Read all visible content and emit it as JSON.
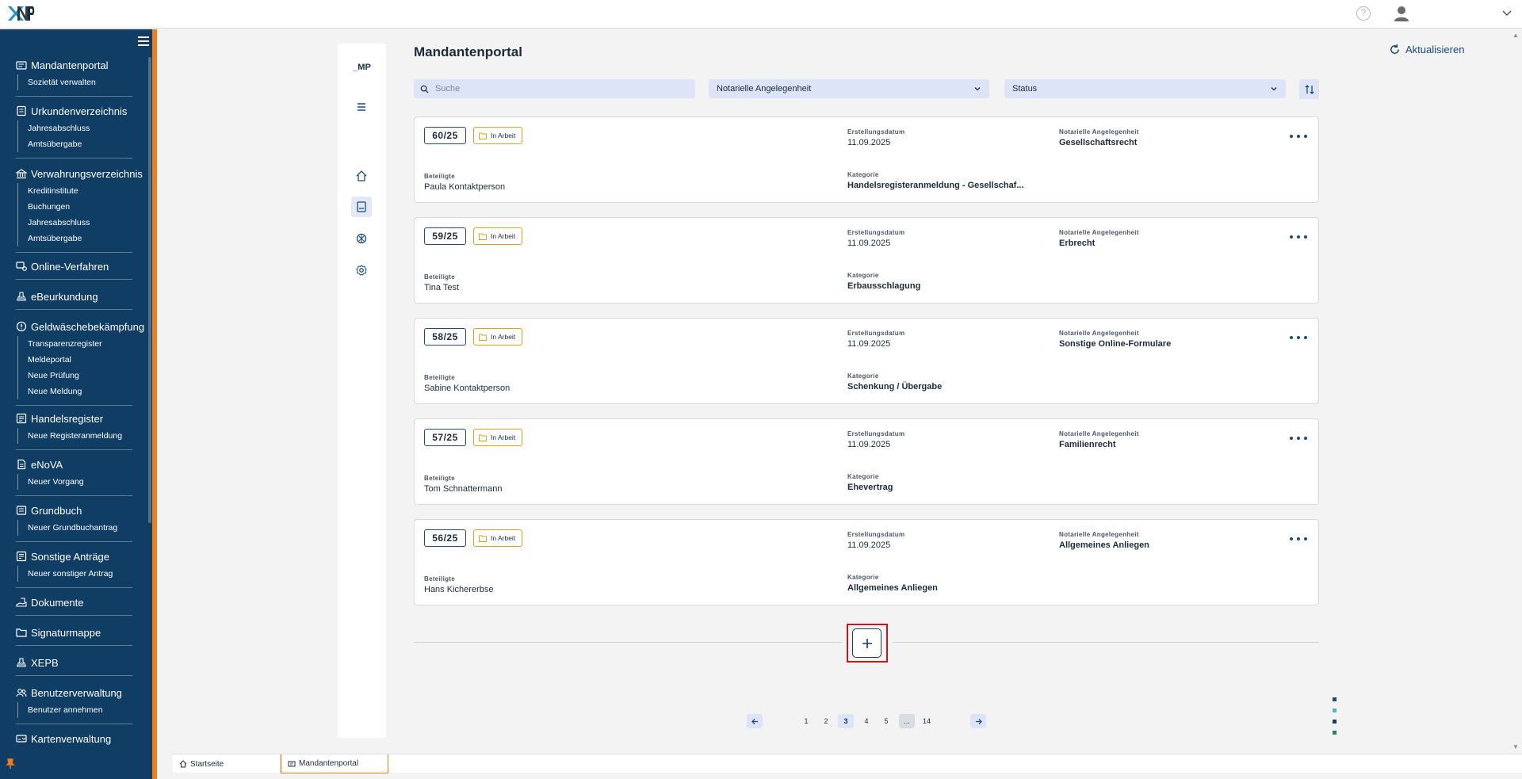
{
  "header": {
    "logo_text": "XNP",
    "help_icon": "?"
  },
  "sidebar": {
    "groups": [
      {
        "label": "Mandantenportal",
        "icon": "portal-icon",
        "subs": [
          "Sozietät verwalten"
        ]
      },
      {
        "label": "Urkundenverzeichnis",
        "icon": "register-icon",
        "subs": [
          "Jahresabschluss",
          "Amtsübergabe"
        ]
      },
      {
        "label": "Verwahrungsverzeichnis",
        "icon": "bank-icon",
        "subs": [
          "Kreditinstitute",
          "Buchungen",
          "Jahresabschluss",
          "Amtsübergabe"
        ]
      },
      {
        "label": "Online-Verfahren",
        "icon": "online-icon",
        "subs": []
      },
      {
        "label": "eBeurkundung",
        "icon": "stamp-icon",
        "subs": []
      },
      {
        "label": "Geldwäschebekämpfung",
        "icon": "alert-icon",
        "subs": [
          "Transparenzregister",
          "Meldeportal",
          "Neue Prüfung",
          "Neue Meldung"
        ]
      },
      {
        "label": "Handelsregister",
        "icon": "list-icon",
        "subs": [
          "Neue Registeranmeldung"
        ]
      },
      {
        "label": "eNoVA",
        "icon": "document-icon",
        "subs": [
          "Neuer Vorgang"
        ]
      },
      {
        "label": "Grundbuch",
        "icon": "book-icon",
        "subs": [
          "Neuer Grundbuchantrag"
        ]
      },
      {
        "label": "Sonstige Anträge",
        "icon": "form-icon",
        "subs": [
          "Neuer sonstiger Antrag"
        ]
      },
      {
        "label": "Dokumente",
        "icon": "hand-doc-icon",
        "subs": []
      },
      {
        "label": "Signaturmappe",
        "icon": "folder-icon",
        "subs": []
      },
      {
        "label": "XEPB",
        "icon": "stamp-icon",
        "subs": []
      },
      {
        "label": "Benutzerverwaltung",
        "icon": "users-icon",
        "subs": [
          "Benutzer annehmen"
        ]
      },
      {
        "label": "Kartenverwaltung",
        "icon": "card-icon",
        "subs": []
      }
    ]
  },
  "inner": {
    "short_label": "_MP"
  },
  "main": {
    "title": "Mandantenportal",
    "refresh_label": "Aktualisieren",
    "search_placeholder": "Suche",
    "filter_matter": "Notarielle Angelegenheit",
    "filter_status": "Status"
  },
  "labels": {
    "created": "Erstellungsdatum",
    "matter": "Notarielle Angelegenheit",
    "participants": "Beteiligte",
    "category": "Kategorie"
  },
  "cards": [
    {
      "number": "60/25",
      "status": "In Arbeit",
      "date": "11.09.2025",
      "matter": "Gesellschaftsrecht",
      "participant": "Paula Kontaktperson",
      "category": "Handelsregisteranmeldung - Gesellschaf..."
    },
    {
      "number": "59/25",
      "status": "In Arbeit",
      "date": "11.09.2025",
      "matter": "Erbrecht",
      "participant": "Tina Test",
      "category": "Erbausschlagung"
    },
    {
      "number": "58/25",
      "status": "In Arbeit",
      "date": "11.09.2025",
      "matter": "Sonstige Online-Formulare",
      "participant": "Sabine Kontaktperson",
      "category": "Schenkung / Übergabe"
    },
    {
      "number": "57/25",
      "status": "In Arbeit",
      "date": "11.09.2025",
      "matter": "Familienrecht",
      "participant": "Tom Schnattermann",
      "category": "Ehevertrag"
    },
    {
      "number": "56/25",
      "status": "In Arbeit",
      "date": "11.09.2025",
      "matter": "Allgemeines Anliegen",
      "participant": "Hans Kichererbse",
      "category": "Allgemeines Anliegen"
    }
  ],
  "pagination": {
    "pages": [
      "1",
      "2",
      "3",
      "4",
      "5",
      "...",
      "14"
    ],
    "current": "3"
  },
  "tabs": [
    {
      "label": "Startseite",
      "icon": "home-icon"
    },
    {
      "label": "Mandantenportal",
      "icon": "portal-icon"
    }
  ],
  "colors": {
    "sidebar": "#0f3d63",
    "accent": "#f07d1a",
    "status_border": "#d8a21a",
    "highlight": "#c0191f"
  }
}
